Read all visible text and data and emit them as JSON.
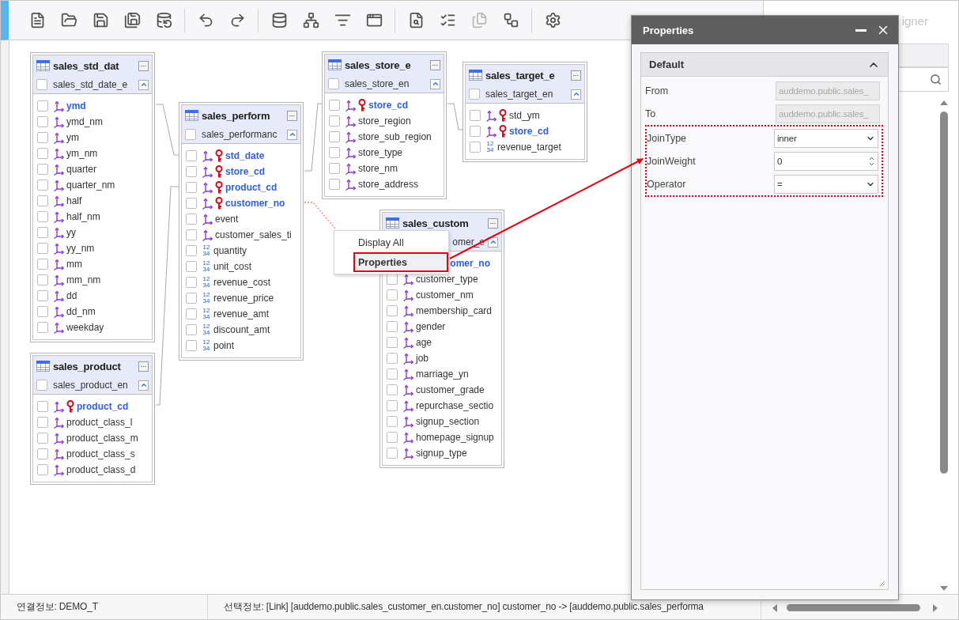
{
  "toolbar": {
    "groups": [
      [
        {
          "disabled": false
        },
        {
          "disabled": false
        },
        {
          "disabled": false
        },
        {
          "disabled": false
        },
        {
          "disabled": false
        }
      ],
      [
        {
          "disabled": false
        },
        {
          "disabled": false
        }
      ],
      [
        {
          "disabled": false
        },
        {
          "disabled": false
        },
        {
          "disabled": false
        },
        {
          "disabled": false
        }
      ],
      [
        {
          "disabled": false
        },
        {
          "disabled": false
        },
        {
          "disabled": true
        },
        {
          "disabled": false
        }
      ],
      [
        {
          "disabled": false
        }
      ]
    ]
  },
  "side_tab": {
    "label": "igner"
  },
  "tables": [
    {
      "title": "sales_std_dat",
      "schema": "sales_std_date_e",
      "schema_checked": false,
      "fields": [
        {
          "name": "ymd",
          "kind": "fk",
          "linked": true,
          "checked": false
        },
        {
          "name": "ymd_nm",
          "kind": "fk",
          "linked": false,
          "checked": false
        },
        {
          "name": "ym",
          "kind": "fk",
          "linked": false,
          "checked": false
        },
        {
          "name": "ym_nm",
          "kind": "fk",
          "linked": false,
          "checked": false
        },
        {
          "name": "quarter",
          "kind": "fk",
          "linked": false,
          "checked": false
        },
        {
          "name": "quarter_nm",
          "kind": "fk",
          "linked": false,
          "checked": false
        },
        {
          "name": "half",
          "kind": "fk",
          "linked": false,
          "checked": false
        },
        {
          "name": "half_nm",
          "kind": "fk",
          "linked": false,
          "checked": false
        },
        {
          "name": "yy",
          "kind": "fk",
          "linked": false,
          "checked": false
        },
        {
          "name": "yy_nm",
          "kind": "fk",
          "linked": false,
          "checked": false
        },
        {
          "name": "mm",
          "kind": "fk",
          "linked": false,
          "checked": false
        },
        {
          "name": "mm_nm",
          "kind": "fk",
          "linked": false,
          "checked": false
        },
        {
          "name": "dd",
          "kind": "fk",
          "linked": false,
          "checked": false
        },
        {
          "name": "dd_nm",
          "kind": "fk",
          "linked": false,
          "checked": false
        },
        {
          "name": "weekday",
          "kind": "fk",
          "linked": false,
          "checked": false
        }
      ]
    },
    {
      "title": "sales_product",
      "schema": "sales_product_en",
      "schema_checked": false,
      "fields": [
        {
          "name": "product_cd",
          "kind": "pk",
          "linked": true,
          "checked": false
        },
        {
          "name": "product_class_l",
          "kind": "fk",
          "linked": false,
          "checked": false
        },
        {
          "name": "product_class_m",
          "kind": "fk",
          "linked": false,
          "checked": false
        },
        {
          "name": "product_class_s",
          "kind": "fk",
          "linked": false,
          "checked": false
        },
        {
          "name": "product_class_d",
          "kind": "fk",
          "linked": false,
          "checked": false
        }
      ]
    },
    {
      "title": "sales_perform",
      "schema": "sales_performanc",
      "schema_checked": false,
      "fields": [
        {
          "name": "std_date",
          "kind": "pk",
          "linked": true,
          "checked": false
        },
        {
          "name": "store_cd",
          "kind": "pk",
          "linked": true,
          "checked": false
        },
        {
          "name": "product_cd",
          "kind": "pk",
          "linked": true,
          "checked": false
        },
        {
          "name": "customer_no",
          "kind": "pk",
          "linked": true,
          "checked": false
        },
        {
          "name": "event",
          "kind": "fk",
          "linked": false,
          "checked": false
        },
        {
          "name": "customer_sales_ti",
          "kind": "fk",
          "linked": false,
          "checked": false
        },
        {
          "name": "quantity",
          "kind": "num",
          "badge": [
            "12",
            "34"
          ],
          "linked": false,
          "checked": false
        },
        {
          "name": "unit_cost",
          "kind": "num",
          "badge": [
            "12",
            "34"
          ],
          "linked": false,
          "checked": false
        },
        {
          "name": "revenue_cost",
          "kind": "num",
          "badge": [
            "12",
            "34"
          ],
          "linked": false,
          "checked": false
        },
        {
          "name": "revenue_price",
          "kind": "num",
          "badge": [
            "12",
            "34"
          ],
          "linked": false,
          "checked": false
        },
        {
          "name": "revenue_amt",
          "kind": "num",
          "badge": [
            "12",
            "34"
          ],
          "linked": false,
          "checked": false
        },
        {
          "name": "discount_amt",
          "kind": "num",
          "badge": [
            "12",
            "34"
          ],
          "linked": false,
          "checked": false
        },
        {
          "name": "point",
          "kind": "num",
          "badge": [
            "12",
            "34"
          ],
          "linked": false,
          "checked": false
        }
      ]
    },
    {
      "title": "sales_store_e",
      "schema": "sales_store_en",
      "schema_checked": false,
      "fields": [
        {
          "name": "store_cd",
          "kind": "pk",
          "linked": true,
          "checked": false
        },
        {
          "name": "store_region",
          "kind": "fk",
          "linked": false,
          "checked": false
        },
        {
          "name": "store_sub_region",
          "kind": "fk",
          "linked": false,
          "checked": false
        },
        {
          "name": "store_type",
          "kind": "fk",
          "linked": false,
          "checked": false
        },
        {
          "name": "store_nm",
          "kind": "fk",
          "linked": false,
          "checked": false
        },
        {
          "name": "store_address",
          "kind": "fk",
          "linked": false,
          "checked": false
        }
      ]
    },
    {
      "title": "sales_target_e",
      "schema": "sales_target_en",
      "schema_checked": false,
      "fields": [
        {
          "name": "std_ym",
          "kind": "pk",
          "linked": false,
          "checked": false
        },
        {
          "name": "store_cd",
          "kind": "pk",
          "linked": true,
          "checked": false
        },
        {
          "name": "revenue_target",
          "kind": "num",
          "badge": [
            "12",
            "34"
          ],
          "linked": false,
          "checked": false
        }
      ]
    },
    {
      "title": "sales_custom",
      "schema": "omer_e",
      "fields": [
        {
          "name": "omer_no",
          "kind": "covered",
          "linked": true
        },
        {
          "name": "customer_type",
          "kind": "fk",
          "linked": false,
          "checked": false
        },
        {
          "name": "customer_nm",
          "kind": "fk",
          "linked": false,
          "checked": false
        },
        {
          "name": "membership_card",
          "kind": "fk",
          "linked": false,
          "checked": false
        },
        {
          "name": "gender",
          "kind": "fk",
          "linked": false,
          "checked": false
        },
        {
          "name": "age",
          "kind": "fk",
          "linked": false,
          "checked": false
        },
        {
          "name": "job",
          "kind": "fk",
          "linked": false,
          "checked": false
        },
        {
          "name": "marriage_yn",
          "kind": "fk",
          "linked": false,
          "checked": false
        },
        {
          "name": "customer_grade",
          "kind": "fk",
          "linked": false,
          "checked": false
        },
        {
          "name": "repurchase_sectio",
          "kind": "fk",
          "linked": false,
          "checked": false
        },
        {
          "name": "signup_section",
          "kind": "fk",
          "linked": false,
          "checked": false
        },
        {
          "name": "homepage_signup",
          "kind": "fk",
          "linked": false,
          "checked": false
        },
        {
          "name": "signup_type",
          "kind": "fk",
          "linked": false,
          "checked": false
        }
      ]
    }
  ],
  "context_menu": {
    "items": [
      {
        "label": "Display All",
        "selected": false
      },
      {
        "label": "Properties",
        "selected": true
      }
    ]
  },
  "properties_dialog": {
    "title": "Properties",
    "section": {
      "title": "Default",
      "expanded": true,
      "rows": [
        {
          "label": "From",
          "kind": "readonly",
          "value": "auddemo.public.sales_",
          "highlighted": false
        },
        {
          "label": "To",
          "kind": "readonly",
          "value": "auddemo.public.sales_",
          "highlighted": false
        },
        {
          "label": "JoinType",
          "kind": "select",
          "value": "inner",
          "highlighted": true
        },
        {
          "label": "JoinWeight",
          "kind": "number",
          "value": "0",
          "highlighted": true
        },
        {
          "label": "Operator",
          "kind": "select",
          "value": "=",
          "highlighted": true
        }
      ]
    }
  },
  "status_bar": {
    "connection": "연결정보: DEMO_T",
    "selection": "선택정보: [Link] [auddemo.public.sales_customer_en.customer_no] customer_no -> [auddemo.public.sales_performa"
  }
}
